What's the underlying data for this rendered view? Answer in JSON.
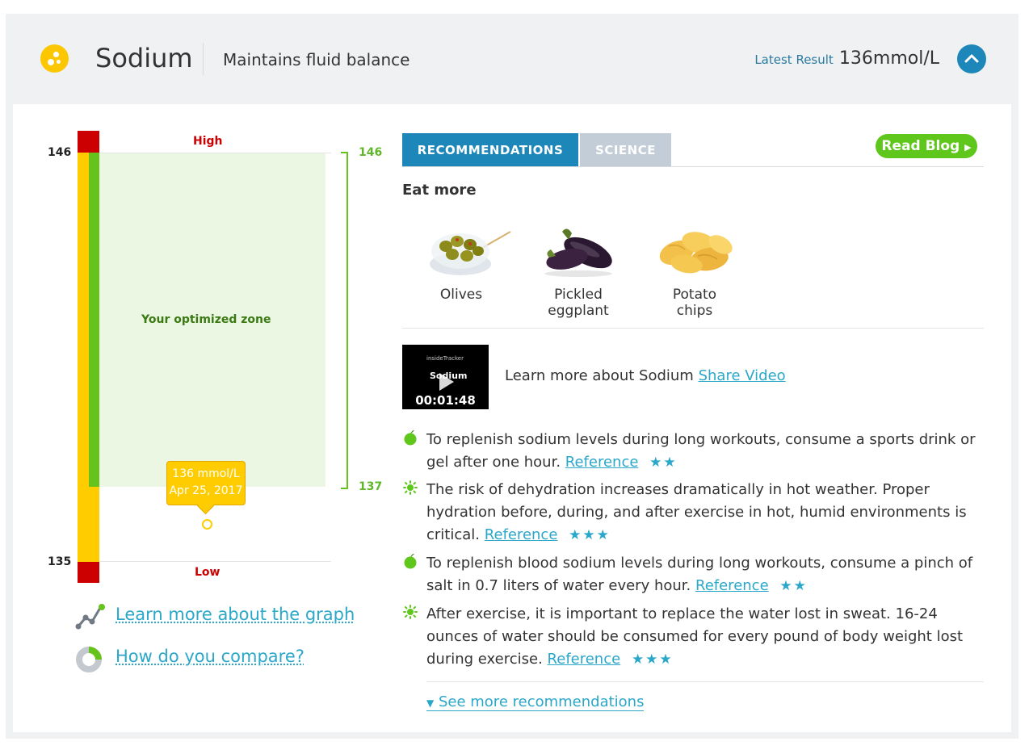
{
  "header": {
    "title": "Sodium",
    "subtitle": "Maintains fluid balance",
    "latest_label": "Latest Result",
    "latest_value": "136mmol/L"
  },
  "graph": {
    "axis_max": "146",
    "axis_min": "135",
    "high_label": "High",
    "low_label": "Low",
    "zone_label": "Your optimized zone",
    "zone_upper": "146",
    "zone_lower": "137",
    "result_value": "136 mmol/L",
    "result_date": "Apr 25, 2017",
    "learn_link": "Learn more about the graph",
    "compare_link": "How do you compare?"
  },
  "tabs": {
    "recommendations": "RECOMMENDATIONS",
    "science": "SCIENCE",
    "read_blog": "Read Blog"
  },
  "eat_more": {
    "heading": "Eat more",
    "foods": [
      {
        "label": "Olives",
        "icon": "olives-image"
      },
      {
        "label": "Pickled eggplant",
        "icon": "eggplant-image"
      },
      {
        "label": "Potato chips",
        "icon": "potato-chips-image"
      }
    ]
  },
  "video": {
    "brand": "insideTracker",
    "title": "Sodium",
    "duration": "00:01:48",
    "text": "Learn more about Sodium",
    "share": "Share Video"
  },
  "recommendations": [
    {
      "text": "To replenish sodium levels during long workouts, consume a sports drink or gel after one hour.",
      "ref": "Reference",
      "stars": "★★",
      "icon": "apple-icon"
    },
    {
      "text": "The risk of dehydration increases dramatically in hot weather. Proper hydration before, during, and after exercise in hot, humid environments is critical.",
      "ref": "Reference",
      "stars": "★★★",
      "icon": "sun-icon"
    },
    {
      "text": "To replenish blood sodium levels during long workouts, consume a pinch of salt in 0.7 liters of water every hour.",
      "ref": "Reference",
      "stars": "★★",
      "icon": "apple-icon"
    },
    {
      "text": "After exercise, it is important to replace the water lost in sweat. 16-24 ounces of water should be consumed for every pound of body weight lost during exercise.",
      "ref": "Reference",
      "stars": "★★★",
      "icon": "sun-icon"
    }
  ],
  "see_more": "See more recommendations",
  "colors": {
    "accent": "#1d87b9",
    "link": "#2aa7c9",
    "green": "#66c31c",
    "yellow": "#ffcc00",
    "red": "#cc0000"
  }
}
